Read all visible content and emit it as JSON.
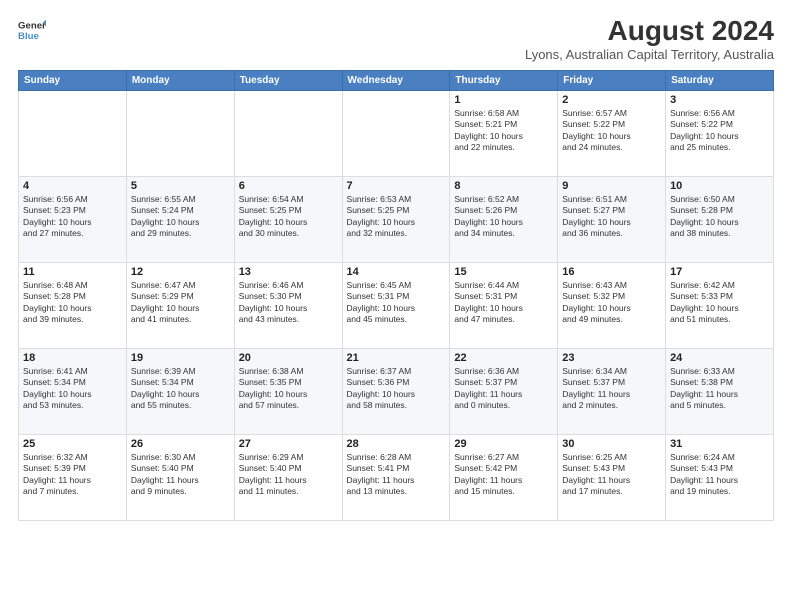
{
  "logo": {
    "line1": "General",
    "line2": "Blue"
  },
  "title": "August 2024",
  "location": "Lyons, Australian Capital Territory, Australia",
  "columns": [
    "Sunday",
    "Monday",
    "Tuesday",
    "Wednesday",
    "Thursday",
    "Friday",
    "Saturday"
  ],
  "weeks": [
    [
      {
        "num": "",
        "info": ""
      },
      {
        "num": "",
        "info": ""
      },
      {
        "num": "",
        "info": ""
      },
      {
        "num": "",
        "info": ""
      },
      {
        "num": "1",
        "info": "Sunrise: 6:58 AM\nSunset: 5:21 PM\nDaylight: 10 hours\nand 22 minutes."
      },
      {
        "num": "2",
        "info": "Sunrise: 6:57 AM\nSunset: 5:22 PM\nDaylight: 10 hours\nand 24 minutes."
      },
      {
        "num": "3",
        "info": "Sunrise: 6:56 AM\nSunset: 5:22 PM\nDaylight: 10 hours\nand 25 minutes."
      }
    ],
    [
      {
        "num": "4",
        "info": "Sunrise: 6:56 AM\nSunset: 5:23 PM\nDaylight: 10 hours\nand 27 minutes."
      },
      {
        "num": "5",
        "info": "Sunrise: 6:55 AM\nSunset: 5:24 PM\nDaylight: 10 hours\nand 29 minutes."
      },
      {
        "num": "6",
        "info": "Sunrise: 6:54 AM\nSunset: 5:25 PM\nDaylight: 10 hours\nand 30 minutes."
      },
      {
        "num": "7",
        "info": "Sunrise: 6:53 AM\nSunset: 5:25 PM\nDaylight: 10 hours\nand 32 minutes."
      },
      {
        "num": "8",
        "info": "Sunrise: 6:52 AM\nSunset: 5:26 PM\nDaylight: 10 hours\nand 34 minutes."
      },
      {
        "num": "9",
        "info": "Sunrise: 6:51 AM\nSunset: 5:27 PM\nDaylight: 10 hours\nand 36 minutes."
      },
      {
        "num": "10",
        "info": "Sunrise: 6:50 AM\nSunset: 5:28 PM\nDaylight: 10 hours\nand 38 minutes."
      }
    ],
    [
      {
        "num": "11",
        "info": "Sunrise: 6:48 AM\nSunset: 5:28 PM\nDaylight: 10 hours\nand 39 minutes."
      },
      {
        "num": "12",
        "info": "Sunrise: 6:47 AM\nSunset: 5:29 PM\nDaylight: 10 hours\nand 41 minutes."
      },
      {
        "num": "13",
        "info": "Sunrise: 6:46 AM\nSunset: 5:30 PM\nDaylight: 10 hours\nand 43 minutes."
      },
      {
        "num": "14",
        "info": "Sunrise: 6:45 AM\nSunset: 5:31 PM\nDaylight: 10 hours\nand 45 minutes."
      },
      {
        "num": "15",
        "info": "Sunrise: 6:44 AM\nSunset: 5:31 PM\nDaylight: 10 hours\nand 47 minutes."
      },
      {
        "num": "16",
        "info": "Sunrise: 6:43 AM\nSunset: 5:32 PM\nDaylight: 10 hours\nand 49 minutes."
      },
      {
        "num": "17",
        "info": "Sunrise: 6:42 AM\nSunset: 5:33 PM\nDaylight: 10 hours\nand 51 minutes."
      }
    ],
    [
      {
        "num": "18",
        "info": "Sunrise: 6:41 AM\nSunset: 5:34 PM\nDaylight: 10 hours\nand 53 minutes."
      },
      {
        "num": "19",
        "info": "Sunrise: 6:39 AM\nSunset: 5:34 PM\nDaylight: 10 hours\nand 55 minutes."
      },
      {
        "num": "20",
        "info": "Sunrise: 6:38 AM\nSunset: 5:35 PM\nDaylight: 10 hours\nand 57 minutes."
      },
      {
        "num": "21",
        "info": "Sunrise: 6:37 AM\nSunset: 5:36 PM\nDaylight: 10 hours\nand 58 minutes."
      },
      {
        "num": "22",
        "info": "Sunrise: 6:36 AM\nSunset: 5:37 PM\nDaylight: 11 hours\nand 0 minutes."
      },
      {
        "num": "23",
        "info": "Sunrise: 6:34 AM\nSunset: 5:37 PM\nDaylight: 11 hours\nand 2 minutes."
      },
      {
        "num": "24",
        "info": "Sunrise: 6:33 AM\nSunset: 5:38 PM\nDaylight: 11 hours\nand 5 minutes."
      }
    ],
    [
      {
        "num": "25",
        "info": "Sunrise: 6:32 AM\nSunset: 5:39 PM\nDaylight: 11 hours\nand 7 minutes."
      },
      {
        "num": "26",
        "info": "Sunrise: 6:30 AM\nSunset: 5:40 PM\nDaylight: 11 hours\nand 9 minutes."
      },
      {
        "num": "27",
        "info": "Sunrise: 6:29 AM\nSunset: 5:40 PM\nDaylight: 11 hours\nand 11 minutes."
      },
      {
        "num": "28",
        "info": "Sunrise: 6:28 AM\nSunset: 5:41 PM\nDaylight: 11 hours\nand 13 minutes."
      },
      {
        "num": "29",
        "info": "Sunrise: 6:27 AM\nSunset: 5:42 PM\nDaylight: 11 hours\nand 15 minutes."
      },
      {
        "num": "30",
        "info": "Sunrise: 6:25 AM\nSunset: 5:43 PM\nDaylight: 11 hours\nand 17 minutes."
      },
      {
        "num": "31",
        "info": "Sunrise: 6:24 AM\nSunset: 5:43 PM\nDaylight: 11 hours\nand 19 minutes."
      }
    ]
  ]
}
